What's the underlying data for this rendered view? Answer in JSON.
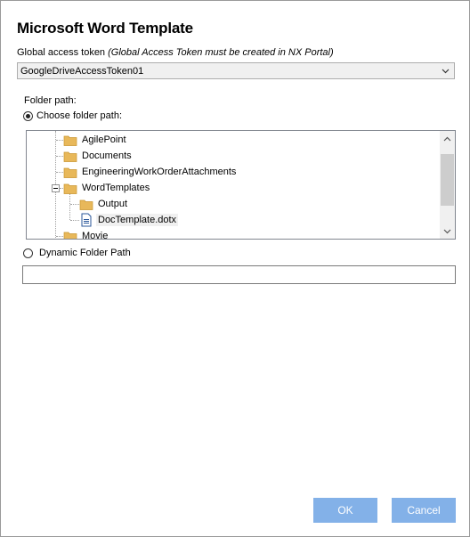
{
  "dialog": {
    "title": "Microsoft Word Template"
  },
  "token": {
    "label": "Global access token",
    "hint": "(Global Access Token must be created in NX Portal)",
    "selected_value": "GoogleDriveAccessToken01"
  },
  "folder": {
    "label": "Folder path:",
    "choose_option_label": "Choose folder path:",
    "choose_selected": true,
    "dynamic_option_label": "Dynamic Folder Path",
    "dynamic_selected": false,
    "dynamic_value": ""
  },
  "tree": {
    "items": [
      {
        "label": "AgilePoint",
        "type": "folder"
      },
      {
        "label": "Documents",
        "type": "folder"
      },
      {
        "label": "EngineeringWorkOrderAttachments",
        "type": "folder"
      },
      {
        "label": "WordTemplates",
        "type": "folder",
        "expanded": true
      },
      {
        "label": "Output",
        "type": "folder"
      },
      {
        "label": "DocTemplate.dotx",
        "type": "file",
        "selected": true
      },
      {
        "label": "Movie",
        "type": "folder"
      }
    ]
  },
  "buttons": {
    "ok_label": "OK",
    "cancel_label": "Cancel"
  },
  "colors": {
    "button_bg": "#83b1e8",
    "folder_icon": "#e8b85a",
    "file_icon": "#2b579a"
  }
}
